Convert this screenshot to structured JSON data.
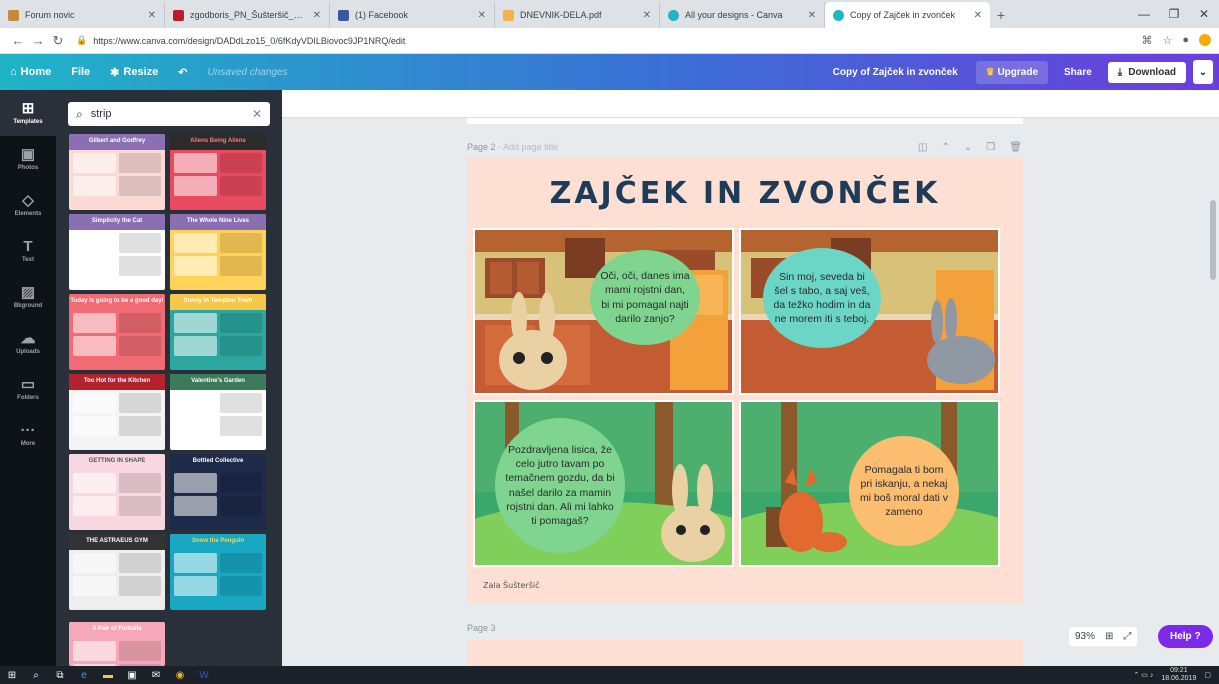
{
  "browser": {
    "tabs": [
      {
        "title": "Forum novic",
        "color": "#c58b3b"
      },
      {
        "title": "zgodboris_PN_Šušteršič_Rakove",
        "color": "#b81d2b"
      },
      {
        "title": "(1) Facebook",
        "color": "#3b5998"
      },
      {
        "title": "DNEVNIK-DELA.pdf",
        "color": "#f5b24a"
      },
      {
        "title": "All your designs - Canva",
        "color": "#1fb4c6"
      },
      {
        "title": "Copy of Zajček in zvonček",
        "color": "#1fb4c6"
      }
    ],
    "new_tab": "+",
    "url": "https://www.canva.com/design/DADdLzo15_0/6fKdyVDILBiovoc9JP1NRQ/edit"
  },
  "toolbar": {
    "home": "Home",
    "file": "File",
    "resize": "Resize",
    "unsaved": "Unsaved changes",
    "doc_title": "Copy of Zajček in zvonček",
    "upgrade": "Upgrade",
    "share": "Share",
    "download": "Download"
  },
  "rail": [
    {
      "label": "Templates",
      "icon": "templates-icon"
    },
    {
      "label": "Photos",
      "icon": "photos-icon"
    },
    {
      "label": "Elements",
      "icon": "elements-icon"
    },
    {
      "label": "Text",
      "icon": "text-icon"
    },
    {
      "label": "Bkground",
      "icon": "background-icon"
    },
    {
      "label": "Uploads",
      "icon": "uploads-icon"
    },
    {
      "label": "Folders",
      "icon": "folders-icon"
    },
    {
      "label": "More",
      "icon": "more-icon"
    }
  ],
  "search": {
    "value": "strip"
  },
  "templates": [
    {
      "title": "Gilbert and Godfrey",
      "bg": "#fbdad6",
      "head": "#8b6fb3",
      "tc": "#fff"
    },
    {
      "title": "Aliens Being Aliens",
      "bg": "#e84a5f",
      "head": "#2b2b2b",
      "tc": "#ff7b7b"
    },
    {
      "title": "Simplicity the Cat",
      "bg": "#fff",
      "head": "#8b6fb3",
      "tc": "#fff"
    },
    {
      "title": "The Whole Nine Lives",
      "bg": "#ffd25a",
      "head": "#8b6fb3",
      "tc": "#fff"
    },
    {
      "title": "Today is going to be a good day!",
      "bg": "#f06b73",
      "head": "#f06b73",
      "tc": "#fff"
    },
    {
      "title": "Sunny in Tempton Town",
      "bg": "#2ba7a0",
      "head": "#f5c84a",
      "tc": "#fff"
    },
    {
      "title": "Too Hot for the Kitchen",
      "bg": "#f4f4f4",
      "head": "#b3232f",
      "tc": "#fff"
    },
    {
      "title": "Valentine's Garden",
      "bg": "#fff",
      "head": "#3d7a5a",
      "tc": "#fff"
    },
    {
      "title": "GETTING IN SHAPE",
      "bg": "#f8d7e0",
      "head": "#f8d7e0",
      "tc": "#555"
    },
    {
      "title": "Bottled Collective",
      "bg": "#1e2a4a",
      "head": "#1e2a4a",
      "tc": "#fff"
    },
    {
      "title": "THE ASTRAEUS GYM",
      "bg": "#eeeeee",
      "head": "#333",
      "tc": "#fff"
    },
    {
      "title": "Snow the Penguin",
      "bg": "#18a8c3",
      "head": "#18a8c3",
      "tc": "#ffd24a"
    },
    {
      "title": "A Pair of Furballs",
      "bg": "#f6a8b8",
      "head": "#f6a8b8",
      "tc": "#fff"
    }
  ],
  "canvas": {
    "page2_label": "Page 2",
    "page2_sub": " - Add page title",
    "page3_label": "Page 3",
    "title": "ZAJČEK IN ZVONČEK",
    "bubbles": [
      "Oči, oči, danes ima mami rojstni dan, bi mi pomagal najti darilo zanjo?",
      "Sin moj, seveda bi šel s tabo, a saj veš, da težko hodim in da ne morem iti s teboj.",
      "Pozdravljena lisica, že celo jutro tavam po temačnem gozdu, da bi našel darilo za mamin rojstni dan. Ali mi lahko ti pomagaš?",
      "Pomagala ti bom pri iskanju, a nekaj mi boš moral dati v zameno"
    ],
    "author": "Zala Šušteršič",
    "zoom": "93%",
    "help": "Help",
    "help_mark": "?"
  },
  "taskbar": {
    "time": "09:21",
    "date": "18.06.2019"
  }
}
